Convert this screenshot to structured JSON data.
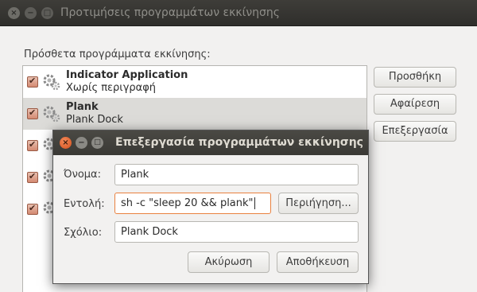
{
  "window": {
    "title": "Προτιμήσεις προγραμμάτων εκκίνησης",
    "close_glyph": "×",
    "min_glyph": "−",
    "max_glyph": "□"
  },
  "list_label": "Πρόσθετα προγράμματα εκκίνησης:",
  "programs": [
    {
      "name": "Indicator Application",
      "description": "Χωρίς περιγραφή",
      "enabled": true
    },
    {
      "name": "Plank",
      "description": "Plank Dock",
      "enabled": true,
      "selected": true
    },
    {
      "name": "",
      "description": "",
      "enabled": true
    },
    {
      "name": "",
      "description": "",
      "enabled": true
    },
    {
      "name": "",
      "description": "",
      "enabled": true
    }
  ],
  "buttons": {
    "add": "Προσθήκη",
    "remove": "Αφαίρεση",
    "edit": "Επεξεργασία"
  },
  "dialog": {
    "title": "Επεξεργασία προγραμμάτων εκκίνησης",
    "close_glyph": "×",
    "min_glyph": "−",
    "max_glyph": "□",
    "name_label": "Όνομα:",
    "name_value": "Plank",
    "command_label": "Εντολή:",
    "command_value": "sh -c \"sleep 20 && plank\"",
    "browse_button": "Περιήγηση...",
    "comment_label": "Σχόλιο:",
    "comment_value": "Plank Dock",
    "cancel_button": "Ακύρωση",
    "save_button": "Αποθήκευση"
  },
  "colors": {
    "accent": "#e9813f",
    "titlebar": "#3c3b37",
    "close_button": "#e0602a"
  }
}
